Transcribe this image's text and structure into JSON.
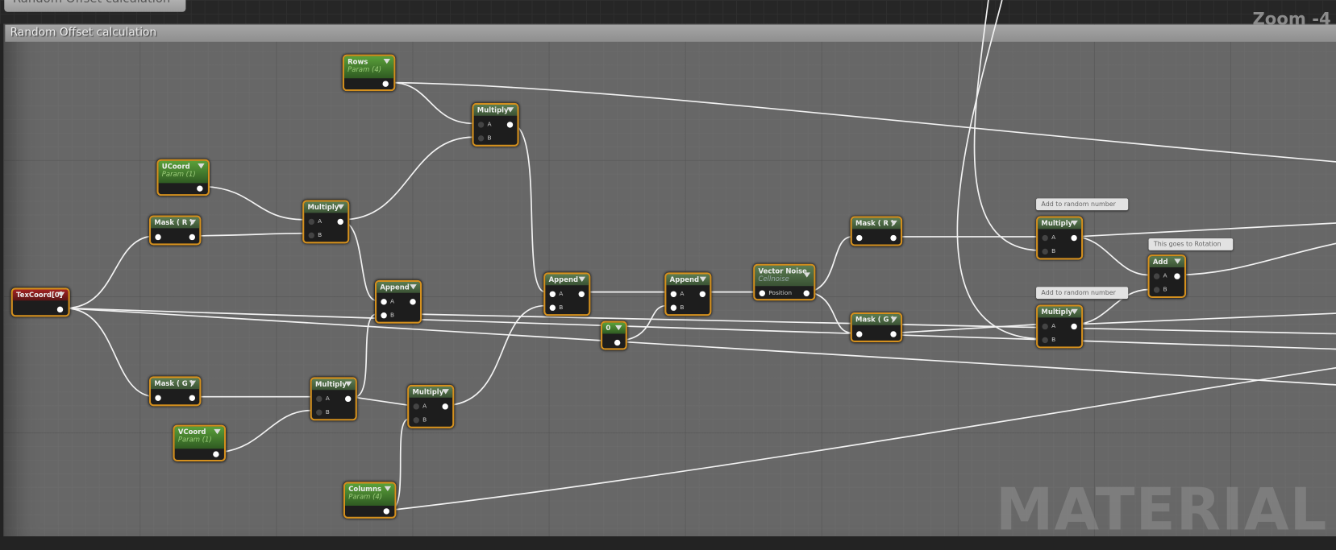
{
  "top_comment": "Random Offset calculation",
  "group_title": "Random Offset calculation",
  "zoom_label": "Zoom -4",
  "watermark": "MATERIAL",
  "nodes": {
    "rows": {
      "title": "Rows",
      "subtitle": "Param (4)"
    },
    "ucoord": {
      "title": "UCoord",
      "subtitle": "Param (1)"
    },
    "vcoord": {
      "title": "VCoord",
      "subtitle": "Param (1)"
    },
    "columns": {
      "title": "Columns",
      "subtitle": "Param (4)"
    },
    "texcoord": {
      "title": "TexCoord[0]"
    },
    "mask_r1": {
      "title": "Mask ( R )"
    },
    "mask_g1": {
      "title": "Mask ( G )"
    },
    "mask_r2": {
      "title": "Mask ( R )"
    },
    "mask_g2": {
      "title": "Mask ( G )"
    },
    "multiply": {
      "title": "Multiply",
      "pin_a": "A",
      "pin_b": "B"
    },
    "append": {
      "title": "Append",
      "pin_a": "A",
      "pin_b": "B"
    },
    "constant": {
      "title": "0"
    },
    "vector_noise": {
      "title": "Vector Noise",
      "subtitle": "Cellnoise",
      "pin": "Position"
    },
    "add": {
      "title": "Add",
      "pin_a": "A",
      "pin_b": "B"
    }
  },
  "comments": {
    "add_random_1": "Add to random number",
    "add_random_2": "Add to random number",
    "rotation": "This goes to Rotation"
  }
}
